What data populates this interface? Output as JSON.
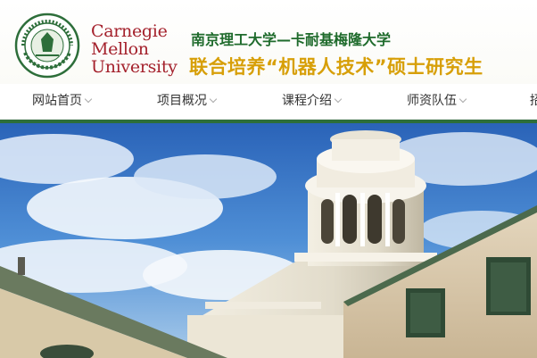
{
  "header": {
    "seal_icon": "nust-university-seal-icon",
    "cmu_logo": [
      "Carnegie",
      "Mellon",
      "University"
    ],
    "title_line1": "南京理工大学—卡耐基梅隆大学",
    "title_line2": "联合培养“机器人技术”硕士研究生"
  },
  "nav": {
    "items": [
      {
        "label": "网站首页"
      },
      {
        "label": "项目概况"
      },
      {
        "label": "课程介绍"
      },
      {
        "label": "师资队伍"
      },
      {
        "label": "招"
      }
    ],
    "chevron_icon": "chevron-down-icon"
  },
  "banner": {
    "image": "campus-building-with-cupola-and-blue-sky"
  },
  "colors": {
    "brand_green": "#2d6e3a",
    "cmu_red": "#a4212c",
    "title_gold": "#d79f08",
    "title_green": "#1f6b2c"
  }
}
